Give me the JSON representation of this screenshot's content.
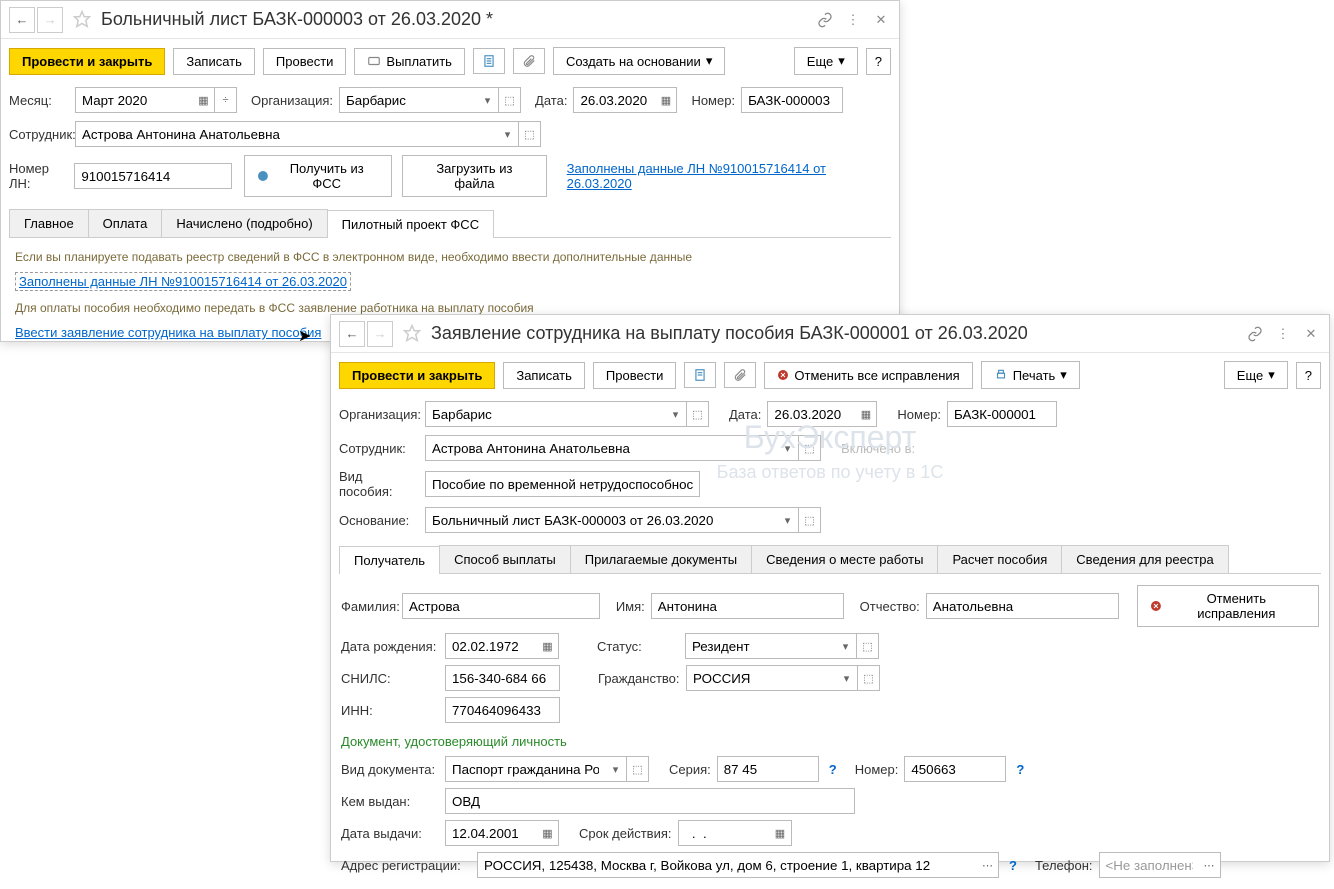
{
  "window1": {
    "title": "Больничный лист БАЗК-000003 от 26.03.2020 *",
    "toolbar": {
      "provesti_zakryt": "Провести и закрыть",
      "zapisat": "Записать",
      "provesti": "Провести",
      "vyplatit": "Выплатить",
      "sozdat": "Создать на основании",
      "eshche": "Еще"
    },
    "form": {
      "month_label": "Месяц:",
      "month": "Март 2020",
      "org_label": "Организация:",
      "org": "Барбарис",
      "date_label": "Дата:",
      "date": "26.03.2020",
      "number_label": "Номер:",
      "number": "БАЗК-000003",
      "employee_label": "Сотрудник:",
      "employee": "Астрова Антонина Анатольевна",
      "ln_label": "Номер ЛН:",
      "ln": "910015716414",
      "get_fss": "Получить из ФСС",
      "load_file": "Загрузить из файла",
      "ln_link": "Заполнены данные ЛН №910015716414 от 26.03.2020"
    },
    "tabs": {
      "main": "Главное",
      "payment": "Оплата",
      "accrued": "Начислено (подробно)",
      "pilot": "Пилотный проект ФСС"
    },
    "content": {
      "info1": "Если вы планируете подавать реестр сведений в ФСС в электронном виде, необходимо ввести дополнительные данные",
      "link1": "Заполнены данные ЛН №910015716414 от 26.03.2020",
      "info2": "Для оплаты пособия необходимо передать в ФСС заявление работника на выплату пособия",
      "link2": "Ввести заявление сотрудника на выплату пособия"
    }
  },
  "window2": {
    "title": "Заявление сотрудника на выплату пособия БАЗК-000001 от 26.03.2020",
    "toolbar": {
      "provesti_zakryt": "Провести и закрыть",
      "zapisat": "Записать",
      "provesti": "Провести",
      "cancel_all": "Отменить все исправления",
      "print": "Печать",
      "eshche": "Еще"
    },
    "form": {
      "org_label": "Организация:",
      "org": "Барбарис",
      "date_label": "Дата:",
      "date": "26.03.2020",
      "number_label": "Номер:",
      "number": "БАЗК-000001",
      "employee_label": "Сотрудник:",
      "employee": "Астрова Антонина Анатольевна",
      "included_label": "Включено в:",
      "benefit_label": "Вид пособия:",
      "benefit": "Пособие по временной нетрудоспособности",
      "basis_label": "Основание:",
      "basis": "Больничный лист БАЗК-000003 от 26.03.2020"
    },
    "tabs": {
      "recipient": "Получатель",
      "payment_method": "Способ выплаты",
      "docs": "Прилагаемые документы",
      "workplace": "Сведения о месте работы",
      "calc": "Расчет пособия",
      "registry": "Сведения для реестра"
    },
    "recipient": {
      "lastname_label": "Фамилия:",
      "lastname": "Астрова",
      "firstname_label": "Имя:",
      "firstname": "Антонина",
      "middlename_label": "Отчество:",
      "middlename": "Анатольевна",
      "cancel": "Отменить исправления",
      "birthdate_label": "Дата рождения:",
      "birthdate": "02.02.1972",
      "status_label": "Статус:",
      "status": "Резидент",
      "snils_label": "СНИЛС:",
      "snils": "156-340-684 66",
      "citizenship_label": "Гражданство:",
      "citizenship": "РОССИЯ",
      "inn_label": "ИНН:",
      "inn": "770464096433",
      "doc_header": "Документ, удостоверяющий личность",
      "doc_type_label": "Вид документа:",
      "doc_type": "Паспорт гражданина Росс",
      "series_label": "Серия:",
      "series": "87 45",
      "doc_number_label": "Номер:",
      "doc_number": "450663",
      "issued_by_label": "Кем выдан:",
      "issued_by": "ОВД",
      "issue_date_label": "Дата выдачи:",
      "issue_date": "12.04.2001",
      "validity_label": "Срок действия:",
      "validity": "  .  .    ",
      "address_label": "Адрес регистрации:",
      "address": "РОССИЯ, 125438, Москва г, Войкова ул, дом 6, строение 1, квартира 12",
      "phone_label": "Телефон:",
      "phone": "<Не заполнен>"
    }
  },
  "watermark": {
    "title": "БухЭксперт",
    "subtitle": "База ответов по учету в 1С"
  }
}
